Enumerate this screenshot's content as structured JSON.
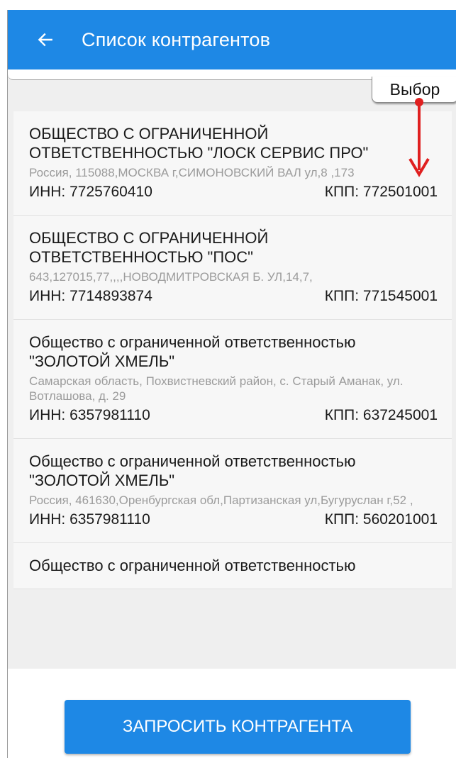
{
  "appbar": {
    "title": "Список контрагентов"
  },
  "tab": {
    "select_label": "Выбор"
  },
  "contractors": [
    {
      "name": "ОБЩЕСТВО С ОГРАНИЧЕННОЙ ОТВЕТСТВЕННОСТЬЮ \"ЛОСК СЕРВИС ПРО\"",
      "address": "Россия, 115088,МОСКВА г,СИМОНОВСКИЙ ВАЛ ул,8 ,173",
      "inn": "ИНН: 7725760410",
      "kpp": "КПП: 772501001"
    },
    {
      "name": "ОБЩЕСТВО С ОГРАНИЧЕННОЙ ОТВЕТСТВЕННОСТЬЮ \"ПОС\"",
      "address": "643,127015,77,,,,НОВОДМИТРОВСКАЯ Б. УЛ,14,7,",
      "inn": "ИНН: 7714893874",
      "kpp": "КПП: 771545001"
    },
    {
      "name": "Общество с ограниченной ответственностью \"ЗОЛОТОЙ ХМЕЛЬ\"",
      "address": "Самарская область, Похвистневский район, с. Старый Аманак, ул. Вотлашова, д. 29",
      "inn": "ИНН: 6357981110",
      "kpp": "КПП: 637245001"
    },
    {
      "name": "Общество с ограниченной ответственностью \"ЗОЛОТОЙ ХМЕЛЬ\"",
      "address": "Россия, 461630,Оренбургская обл,Партизанская ул,Бугуруслан г,52 ,",
      "inn": "ИНН: 6357981110",
      "kpp": "КПП: 560201001"
    },
    {
      "name": "Общество с ограниченной ответственностью",
      "address": "",
      "inn": "",
      "kpp": ""
    }
  ],
  "footer": {
    "request_button": "ЗАПРОСИТЬ КОНТРАГЕНТА"
  },
  "colors": {
    "primary": "#1e88e5",
    "annotation_arrow": "#e02020"
  },
  "icons": [
    "back-arrow-icon"
  ]
}
